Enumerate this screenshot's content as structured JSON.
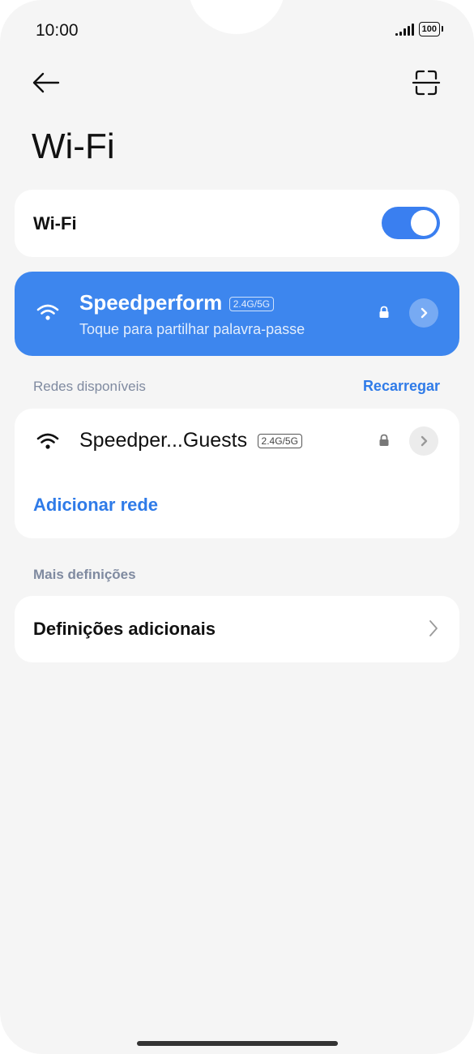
{
  "status_bar": {
    "time": "10:00",
    "battery": "100"
  },
  "header": {
    "title": "Wi-Fi"
  },
  "wifi_toggle": {
    "label": "Wi-Fi",
    "enabled": true
  },
  "connected_network": {
    "name": "Speedperform",
    "band": "2.4G/5G",
    "subtitle": "Toque para partilhar palavra-passe"
  },
  "available_section": {
    "title": "Redes disponíveis",
    "refresh_label": "Recarregar",
    "networks": [
      {
        "name": "Speedper...Guests",
        "band": "2.4G/5G",
        "secured": true
      }
    ],
    "add_network_label": "Adicionar rede"
  },
  "more_section": {
    "title": "Mais definições",
    "items": [
      {
        "label": "Definições adicionais"
      }
    ]
  },
  "colors": {
    "accent": "#3a7ff0",
    "connected_card": "#3d86ee",
    "background": "#f5f5f5",
    "section_header": "#7f8aa0"
  },
  "icons": {
    "back": "back-arrow-icon",
    "scan": "scan-icon",
    "wifi": "wifi-icon",
    "lock": "lock-icon",
    "chevron": "chevron-right-icon"
  }
}
